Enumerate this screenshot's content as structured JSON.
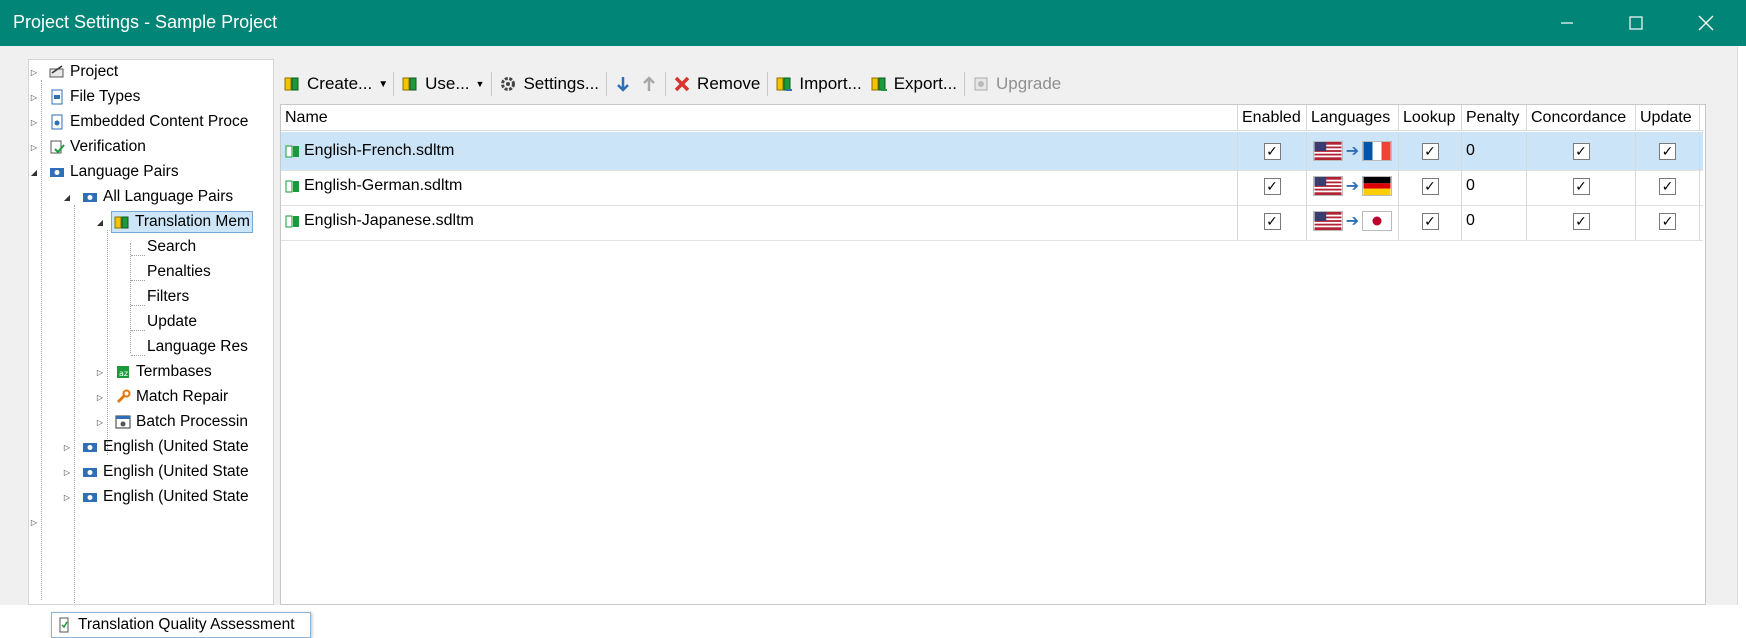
{
  "window": {
    "title": "Project Settings - Sample Project",
    "controls": [
      "minimize-icon",
      "maximize-icon",
      "close-icon"
    ]
  },
  "tree": {
    "items": [
      {
        "label": "Project",
        "icon": "project-icon",
        "expanded": false
      },
      {
        "label": "File Types",
        "icon": "file-types-icon",
        "expanded": false
      },
      {
        "label": "Embedded Content Proce",
        "icon": "embedded-content-icon",
        "expanded": false
      },
      {
        "label": "Verification",
        "icon": "verification-icon",
        "expanded": false
      },
      {
        "label": "Language Pairs",
        "icon": "language-pairs-icon",
        "expanded": true
      },
      {
        "label": "All Language Pairs",
        "icon": "language-pair-icon",
        "expanded": true
      },
      {
        "label": "Translation Mem",
        "icon": "translation-memory-icon",
        "expanded": true,
        "selected": true
      },
      {
        "label": "Search"
      },
      {
        "label": "Penalties"
      },
      {
        "label": "Filters"
      },
      {
        "label": "Update"
      },
      {
        "label": "Language Res"
      },
      {
        "label": "Termbases",
        "icon": "termbase-icon",
        "expanded": false
      },
      {
        "label": "Match Repair",
        "icon": "wrench-icon",
        "expanded": false
      },
      {
        "label": "Batch Processin",
        "icon": "batch-processing-icon",
        "expanded": false
      },
      {
        "label": "English (United State",
        "icon": "language-pair-icon",
        "expanded": false
      },
      {
        "label": "English (United State",
        "icon": "language-pair-icon",
        "expanded": false
      },
      {
        "label": "English (United State",
        "icon": "language-pair-icon",
        "expanded": false
      }
    ],
    "tqa_label": "Translation Quality Assessment"
  },
  "toolbar": {
    "create": "Create...",
    "use": "Use...",
    "settings": "Settings...",
    "remove": "Remove",
    "import": "Import...",
    "export": "Export...",
    "upgrade": "Upgrade"
  },
  "grid": {
    "columns": {
      "name": "Name",
      "enabled": "Enabled",
      "languages": "Languages",
      "lookup": "Lookup",
      "penalty": "Penalty",
      "concordance": "Concordance",
      "update": "Update"
    },
    "rows": [
      {
        "name": "English-French.sdltm",
        "enabled": true,
        "source_flag": "us-flag-icon",
        "target_flag": "france-flag-icon",
        "lookup": true,
        "penalty": "0",
        "concordance": true,
        "update": true,
        "selected": true
      },
      {
        "name": "English-German.sdltm",
        "enabled": true,
        "source_flag": "us-flag-icon",
        "target_flag": "germany-flag-icon",
        "lookup": true,
        "penalty": "0",
        "concordance": true,
        "update": true,
        "selected": false
      },
      {
        "name": "English-Japanese.sdltm",
        "enabled": true,
        "source_flag": "us-flag-icon",
        "target_flag": "japan-flag-icon",
        "lookup": true,
        "penalty": "0",
        "concordance": true,
        "update": true,
        "selected": false
      }
    ]
  },
  "colors": {
    "titlebar": "#008577",
    "selection": "#cce4f7",
    "remove_red": "#d9342b",
    "arrow_blue": "#2f6fb6"
  }
}
